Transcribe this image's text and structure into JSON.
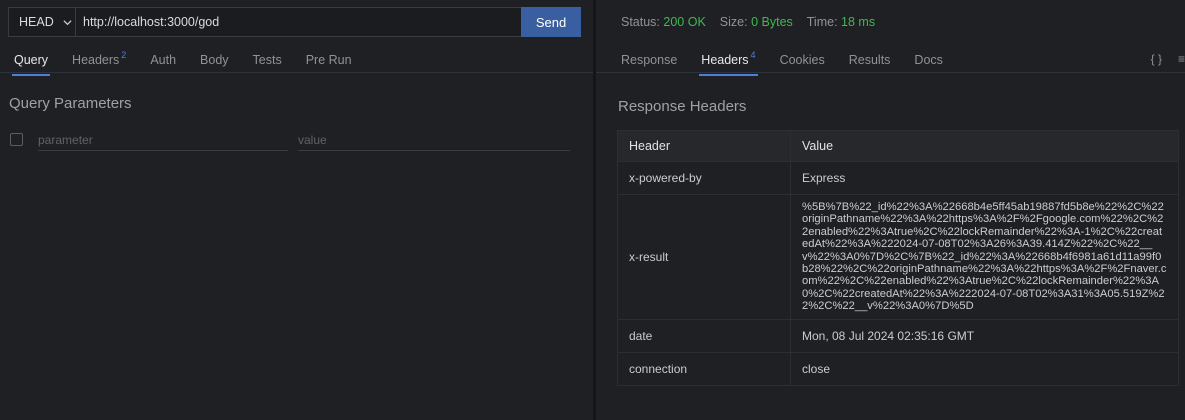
{
  "request": {
    "method": "HEAD",
    "url": "http://localhost:3000/god",
    "send_label": "Send",
    "tabs": [
      {
        "label": "Query"
      },
      {
        "label": "Headers",
        "badge": "2"
      },
      {
        "label": "Auth"
      },
      {
        "label": "Body"
      },
      {
        "label": "Tests"
      },
      {
        "label": "Pre Run"
      }
    ],
    "query_title": "Query Parameters",
    "param_placeholder": "parameter",
    "value_placeholder": "value"
  },
  "response": {
    "status_label": "Status:",
    "status_value": "200 OK",
    "size_label": "Size:",
    "size_value": "0 Bytes",
    "time_label": "Time:",
    "time_value": "18 ms",
    "tabs": [
      {
        "label": "Response"
      },
      {
        "label": "Headers",
        "badge": "4"
      },
      {
        "label": "Cookies"
      },
      {
        "label": "Results"
      },
      {
        "label": "Docs"
      }
    ],
    "braces_icon": "{ }",
    "menu_icon": "≡",
    "section_title": "Response Headers",
    "columns": [
      "Header",
      "Value"
    ],
    "rows": [
      {
        "key": "x-powered-by",
        "value": "Express"
      },
      {
        "key": "x-result",
        "value": "%5B%7B%22_id%22%3A%22668b4e5ff45ab19887fd5b8e%22%2C%22originPathname%22%3A%22https%3A%2F%2Fgoogle.com%22%2C%22enabled%22%3Atrue%2C%22lockRemainder%22%3A-1%2C%22createdAt%22%3A%222024-07-08T02%3A26%3A39.414Z%22%2C%22__v%22%3A0%7D%2C%7B%22_id%22%3A%22668b4f6981a61d11a99f0b28%22%2C%22originPathname%22%3A%22https%3A%2F%2Fnaver.com%22%2C%22enabled%22%3Atrue%2C%22lockRemainder%22%3A0%2C%22createdAt%22%3A%222024-07-08T02%3A31%3A05.519Z%22%2C%22__v%22%3A0%7D%5D"
      },
      {
        "key": "date",
        "value": "Mon, 08 Jul 2024 02:35:16 GMT"
      },
      {
        "key": "connection",
        "value": "close"
      }
    ]
  },
  "colors": {
    "accent": "#4d7fd6",
    "send": "#3a5fa0",
    "ok": "#3fb950"
  }
}
